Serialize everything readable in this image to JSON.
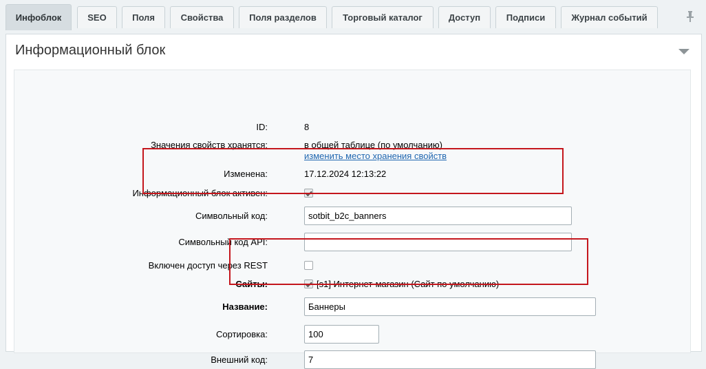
{
  "tabs": [
    {
      "label": "Инфоблок",
      "active": true
    },
    {
      "label": "SEO"
    },
    {
      "label": "Поля"
    },
    {
      "label": "Свойства"
    },
    {
      "label": "Поля разделов"
    },
    {
      "label": "Торговый каталог"
    },
    {
      "label": "Доступ"
    },
    {
      "label": "Подписи"
    },
    {
      "label": "Журнал событий"
    }
  ],
  "pin_icon": "pin-icon",
  "section": {
    "title": "Информационный блок",
    "collapse_icon": "triangle-down-icon"
  },
  "form": {
    "id": {
      "label": "ID:",
      "value": "8"
    },
    "storage": {
      "label": "Значения свойств хранятся:",
      "value": "в общей таблице (по умолчанию)",
      "link": "изменить место хранения свойств"
    },
    "modified": {
      "label": "Изменена:",
      "value": "17.12.2024 12:13:22"
    },
    "active": {
      "label": "Информационный блок активен:",
      "checked": true
    },
    "code": {
      "label": "Символьный код:",
      "value": "sotbit_b2c_banners"
    },
    "api_code": {
      "label": "Символьный код API:",
      "value": ""
    },
    "rest": {
      "label": "Включен доступ через REST",
      "checked": false
    },
    "sites": {
      "label": "Сайты:",
      "checked": true,
      "option": "[s1] Интернет-магазин (Сайт по умолчанию)"
    },
    "name": {
      "label": "Название:",
      "value": "Баннеры"
    },
    "sort": {
      "label": "Сортировка:",
      "value": "100"
    },
    "external_code": {
      "label": "Внешний код:",
      "value": "7"
    }
  },
  "colors": {
    "highlight": "#c4161c",
    "link": "#2067b0",
    "active_tab": "#d6dde1"
  }
}
